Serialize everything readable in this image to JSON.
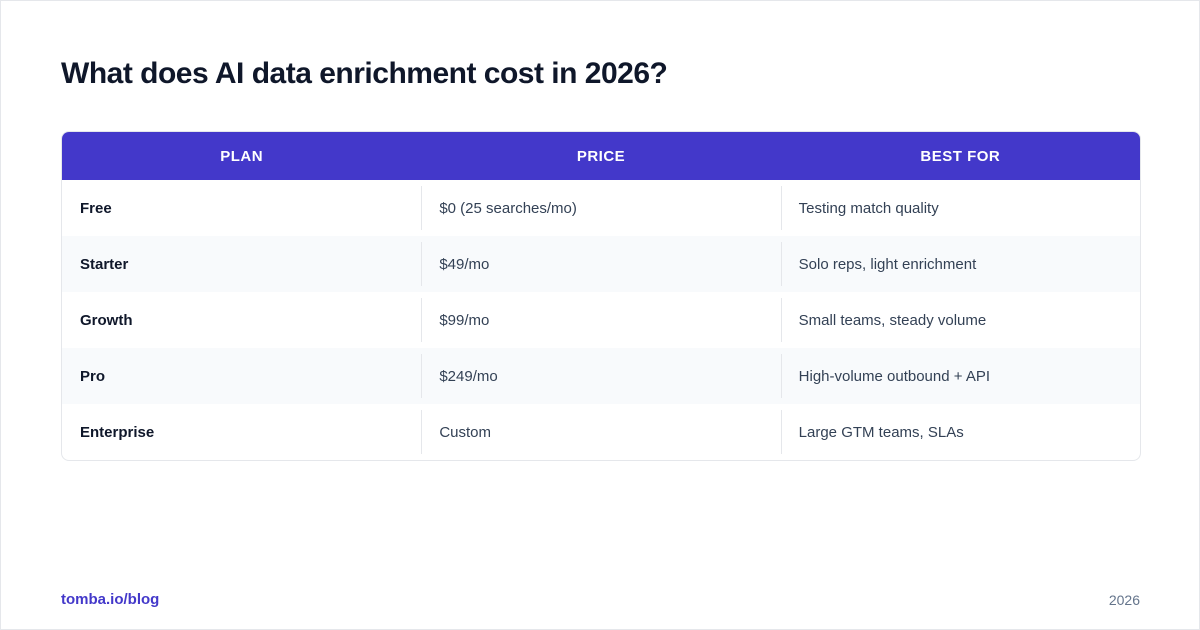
{
  "page": {
    "title": "What does AI data enrichment cost in 2026?"
  },
  "table": {
    "columns": [
      "PLAN",
      "PRICE",
      "BEST FOR"
    ],
    "rows": [
      [
        "Free",
        "$0 (25 searches/mo)",
        "Testing match quality"
      ],
      [
        "Starter",
        "$49/mo",
        "Solo reps, light enrichment"
      ],
      [
        "Growth",
        "$99/mo",
        "Small teams, steady volume"
      ],
      [
        "Pro",
        "$249/mo",
        "High-volume outbound + API"
      ],
      [
        "Enterprise",
        "Custom",
        "Large GTM teams, SLAs"
      ]
    ]
  },
  "footer": {
    "link": "tomba.io/blog",
    "year": "2026"
  },
  "colors": {
    "accent": "#4338ca",
    "header_text": "#ffffff",
    "row_alt": "#f8fafc",
    "title": "#0f172a"
  }
}
